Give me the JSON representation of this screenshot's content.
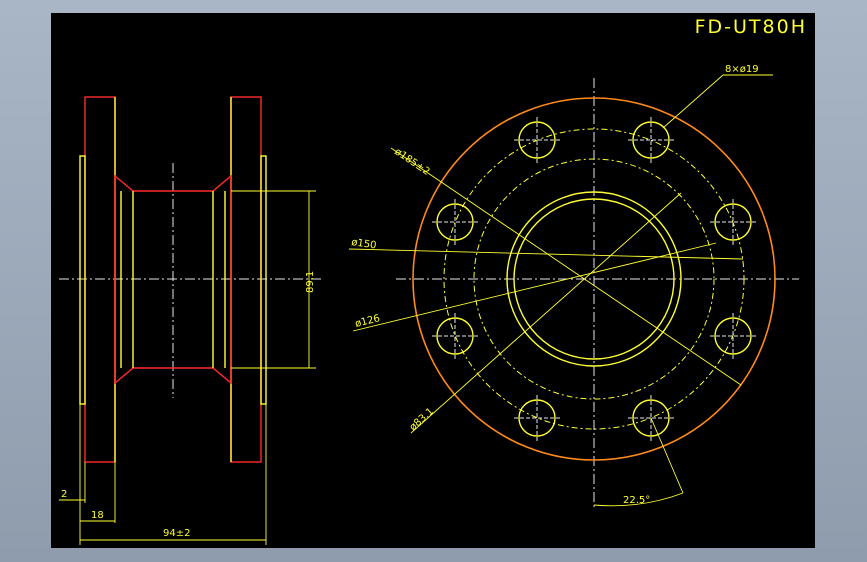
{
  "drawing": {
    "title": "FD-UT80H",
    "labels": {
      "bolt_holes": "8×ø19",
      "d185": "ø185±2",
      "d150": "ø150",
      "d126": "ø126",
      "d83": "ø83.1",
      "angle": "22.5°",
      "h89": "89.1",
      "w2": "2",
      "w18": "18",
      "w94": "94±2"
    }
  },
  "colors": {
    "background": "#000000",
    "primary_lines": "#ffff33",
    "flange_outline": "#ff2a2a",
    "outer_circle": "#ff8a1a",
    "center_lines": "#e8e8e8",
    "frame": "#9aa8b8"
  }
}
